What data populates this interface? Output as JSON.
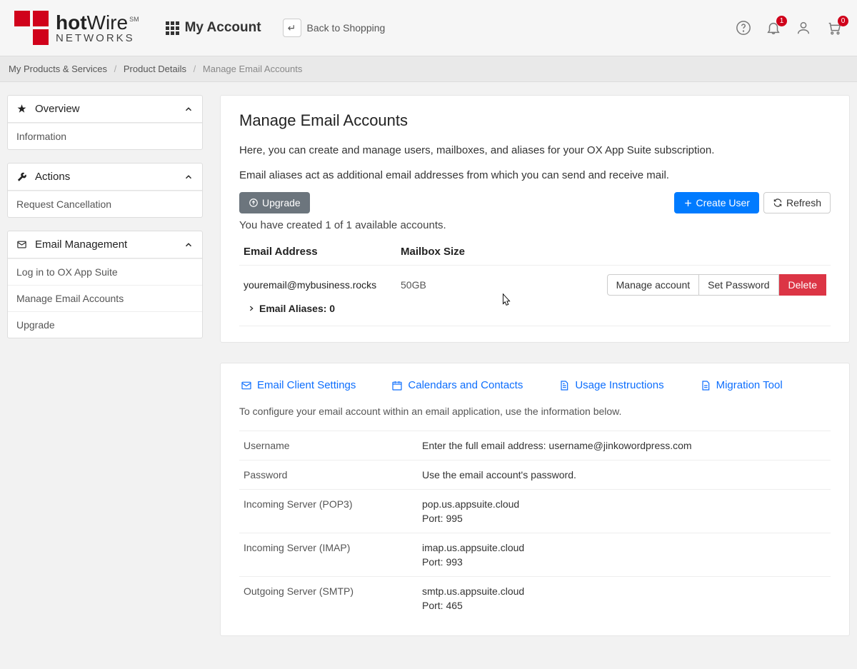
{
  "header": {
    "logo_top_1": "hot",
    "logo_top_2": "Wire",
    "logo_sm": "SM",
    "logo_bottom": "NETWORKS",
    "my_account": "My Account",
    "back_to_shopping": "Back to Shopping",
    "bell_badge": "1",
    "cart_badge": "0"
  },
  "breadcrumb": {
    "a": "My Products & Services",
    "b": "Product Details",
    "c": "Manage Email Accounts"
  },
  "sidebar": {
    "overview": {
      "title": "Overview",
      "items": [
        "Information"
      ]
    },
    "actions": {
      "title": "Actions",
      "items": [
        "Request Cancellation"
      ]
    },
    "email": {
      "title": "Email Management",
      "items": [
        "Log in to OX App Suite",
        "Manage Email Accounts",
        "Upgrade"
      ]
    }
  },
  "main": {
    "title": "Manage Email Accounts",
    "p1": "Here, you can create and manage users, mailboxes, and aliases for your OX App Suite subscription.",
    "p2": "Email aliases act as additional email addresses from which you can send and receive mail.",
    "upgrade_btn": "Upgrade",
    "create_user_btn": "Create User",
    "refresh_btn": "Refresh",
    "created_text": "You have created 1 of 1 available accounts.",
    "col1": "Email Address",
    "col2": "Mailbox Size",
    "row": {
      "email": "youremail@mybusiness.rocks",
      "size": "50GB",
      "manage": "Manage account",
      "setpw": "Set Password",
      "delete": "Delete",
      "aliases": "Email Aliases: 0"
    }
  },
  "tabs": {
    "a": "Email Client Settings",
    "b": "Calendars and Contacts",
    "c": "Usage Instructions",
    "d": "Migration Tool"
  },
  "settings": {
    "desc": "To configure your email account within an email application, use the information below.",
    "rows": [
      {
        "label": "Username",
        "value": "Enter the full email address: username@jinkowordpress.com"
      },
      {
        "label": "Password",
        "value": "Use the email account's password."
      },
      {
        "label": "Incoming Server (POP3)",
        "value": "pop.us.appsuite.cloud",
        "port": "Port: 995"
      },
      {
        "label": "Incoming Server (IMAP)",
        "value": "imap.us.appsuite.cloud",
        "port": "Port: 993"
      },
      {
        "label": "Outgoing Server (SMTP)",
        "value": "smtp.us.appsuite.cloud",
        "port": "Port: 465"
      }
    ]
  }
}
